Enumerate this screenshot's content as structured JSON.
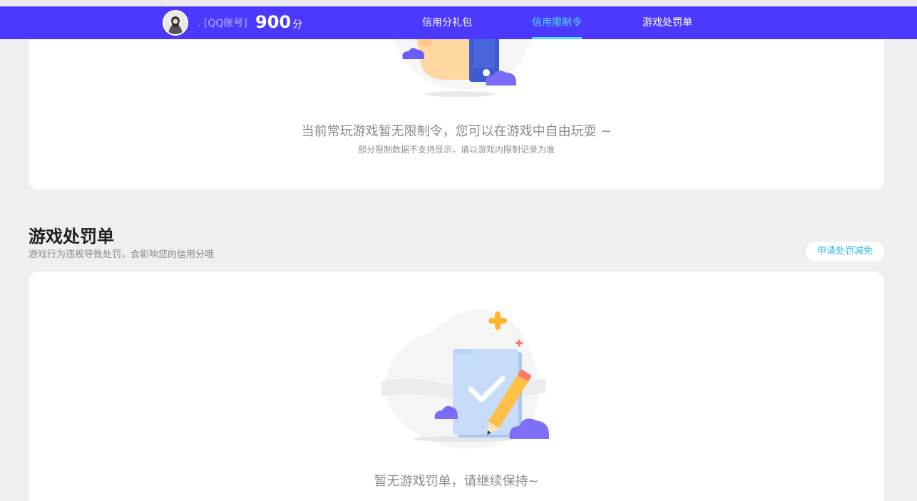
{
  "header": {
    "account_label": ". [QQ账号]",
    "score": "900",
    "score_unit": "分",
    "tabs": [
      {
        "label": "信用分礼包",
        "active": false
      },
      {
        "label": "信用限制令",
        "active": true
      },
      {
        "label": "游戏处罚单",
        "active": false
      }
    ]
  },
  "restriction": {
    "empty_text": "当前常玩游戏暂无限制令，您可以在游戏中自由玩耍 ~",
    "note": "部分限制数据不支持显示，请以游戏内限制记录为准"
  },
  "penalty": {
    "title": "游戏处罚单",
    "description": "游戏行为违规导致处罚，会影响您的信用分哦",
    "appeal_button": "申请处罚减免",
    "empty_text": "暂无游戏罚单，请继续保持~"
  },
  "colors": {
    "header_bg": "#4b3afd",
    "active_tab": "#4ee0ff",
    "appeal_text": "#35b7e9",
    "page_bg": "#efefef"
  },
  "icons": [
    "avatar-image",
    "hand-phone-illustration",
    "document-check-illustration",
    "cloud-icon",
    "sparkle-icon"
  ]
}
